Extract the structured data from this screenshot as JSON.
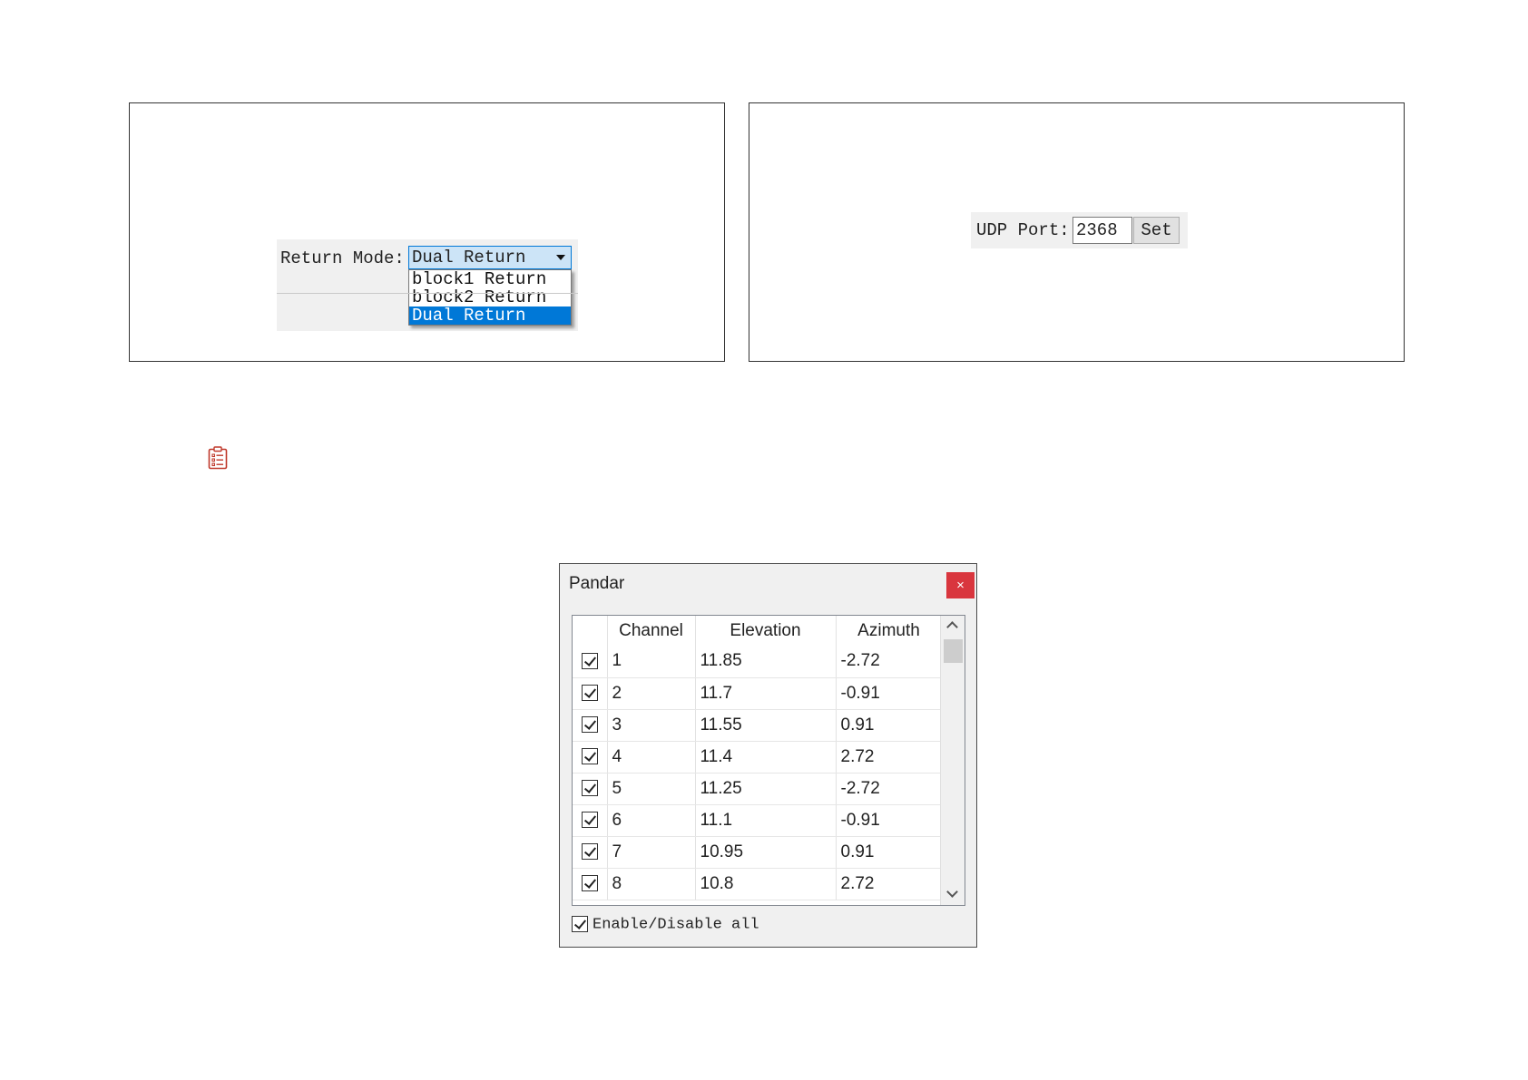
{
  "return_mode": {
    "label": "Return Mode:",
    "selected": "Dual Return",
    "options": [
      "block1 Return",
      "block2 Return",
      "Dual Return"
    ]
  },
  "udp": {
    "label": "UDP Port:",
    "value": "2368",
    "button": "Set"
  },
  "dialog": {
    "title": "Pandar",
    "close": "×",
    "columns": [
      "Channel",
      "Elevation",
      "Azimuth"
    ],
    "rows": [
      {
        "channel": "1",
        "elevation": "11.85",
        "azimuth": "-2.72",
        "checked": true
      },
      {
        "channel": "2",
        "elevation": "11.7",
        "azimuth": "-0.91",
        "checked": true
      },
      {
        "channel": "3",
        "elevation": "11.55",
        "azimuth": "0.91",
        "checked": true
      },
      {
        "channel": "4",
        "elevation": "11.4",
        "azimuth": "2.72",
        "checked": true
      },
      {
        "channel": "5",
        "elevation": "11.25",
        "azimuth": "-2.72",
        "checked": true
      },
      {
        "channel": "6",
        "elevation": "11.1",
        "azimuth": "-0.91",
        "checked": true
      },
      {
        "channel": "7",
        "elevation": "10.95",
        "azimuth": "0.91",
        "checked": true
      },
      {
        "channel": "8",
        "elevation": "10.8",
        "azimuth": "2.72",
        "checked": true
      }
    ],
    "enable_all_label": "Enable/Disable all"
  },
  "icons": {
    "note": "clipboard-list-icon",
    "note_color": "#c0392b"
  }
}
